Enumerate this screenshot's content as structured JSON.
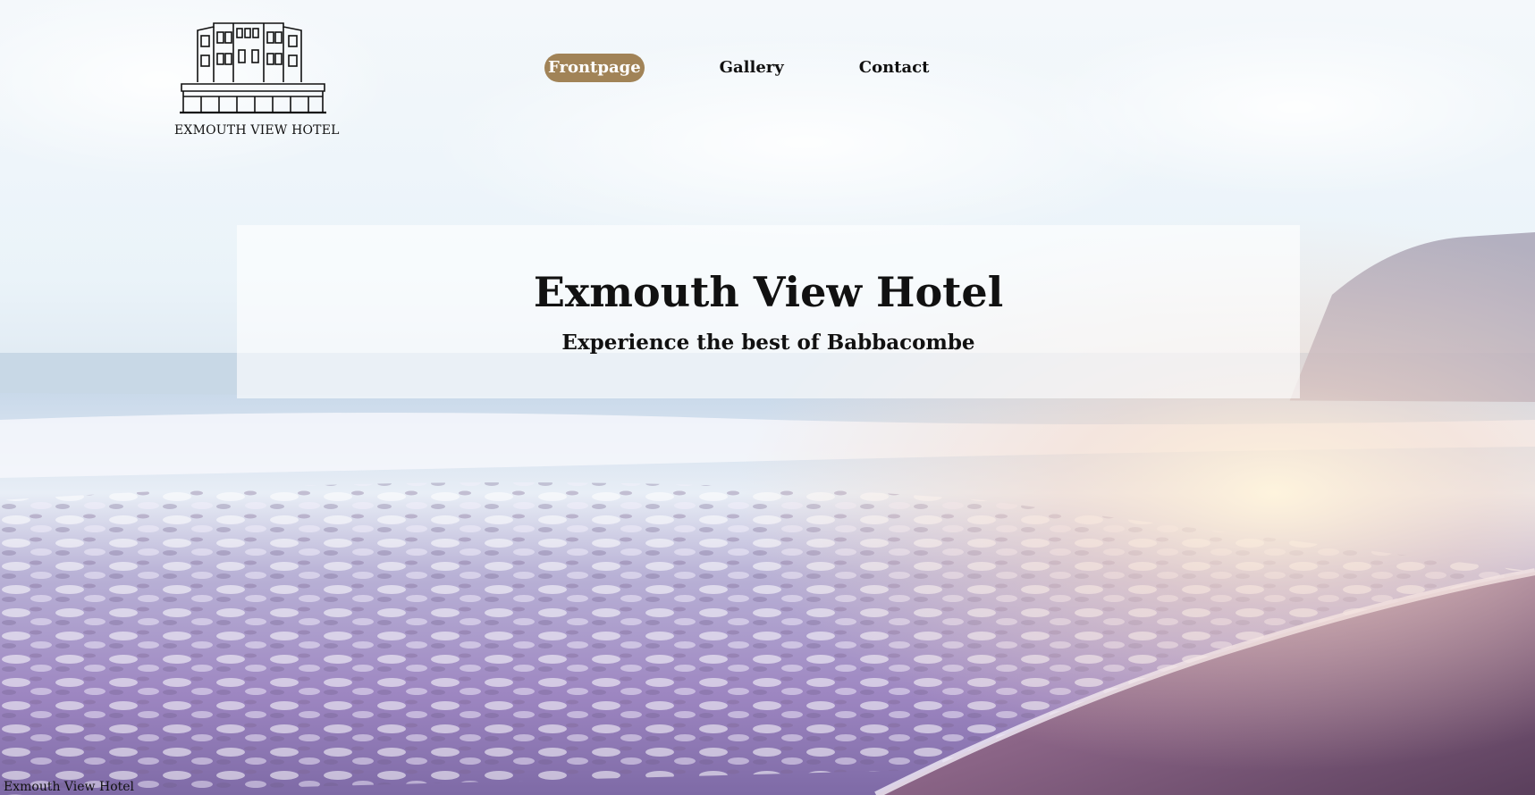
{
  "site": {
    "logo_text": "EXMOUTH VIEW HOTEL"
  },
  "nav": {
    "items": [
      {
        "label": "Frontpage",
        "active": true
      },
      {
        "label": "Gallery",
        "active": false
      },
      {
        "label": "Contact",
        "active": false
      }
    ]
  },
  "hero": {
    "title": "Exmouth View Hotel",
    "subtitle": "Experience the best of Babbacombe"
  },
  "footer": {
    "text": "Exmouth View Hotel"
  },
  "colors": {
    "nav_active_bg": "#a18357",
    "nav_active_text": "#ffffff",
    "text": "#111111"
  },
  "icons": {
    "logo": "hotel-building-icon"
  }
}
